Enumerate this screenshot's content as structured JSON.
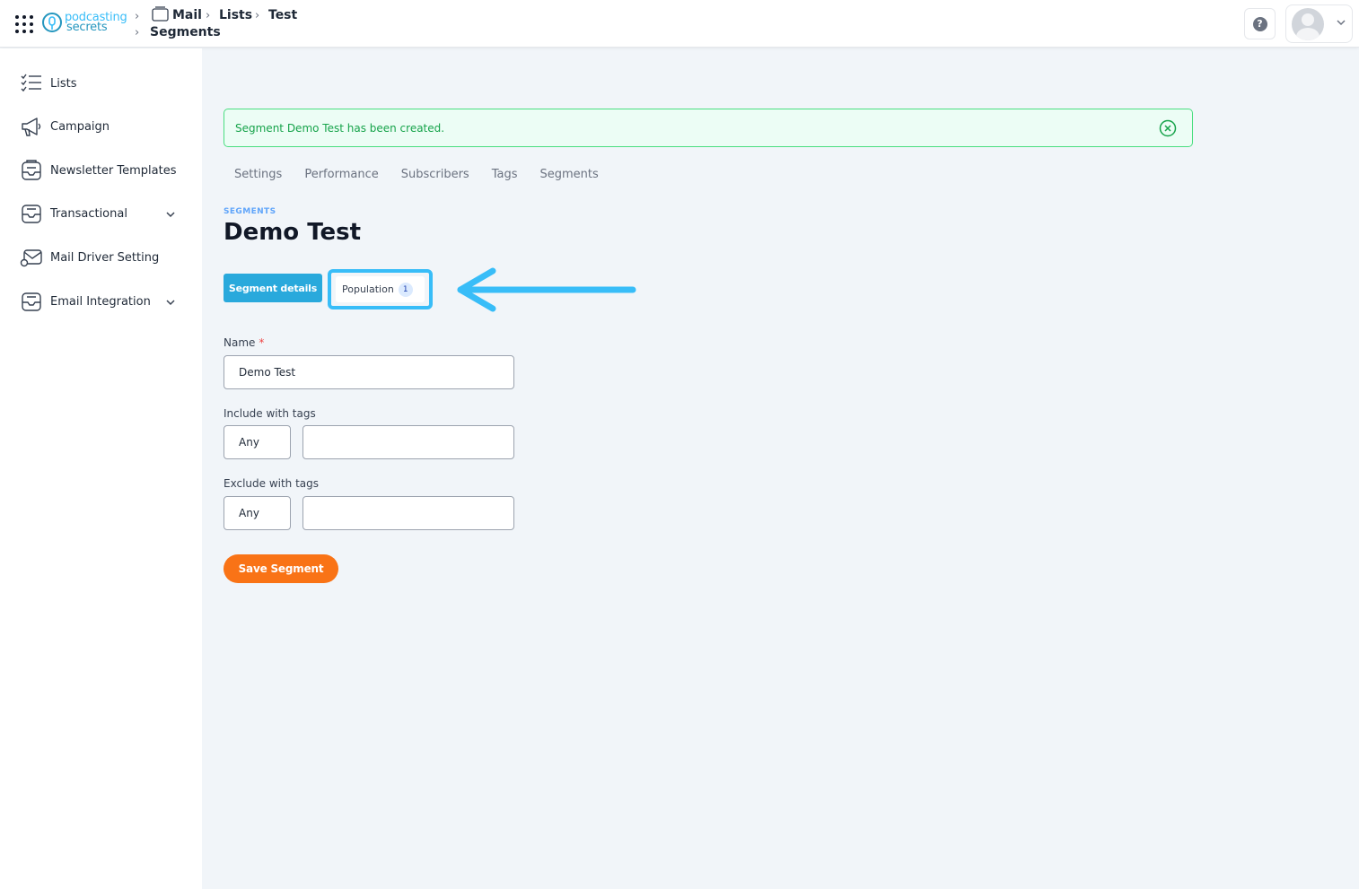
{
  "header": {
    "logo_line1": "podcasting",
    "logo_line2": "secrets",
    "breadcrumb": [
      "Mail",
      "Lists",
      "Test",
      "Segments"
    ],
    "help_icon": "question-circle-icon",
    "avatar_icon": "user-avatar-icon"
  },
  "sidebar": {
    "items": [
      {
        "label": "Lists",
        "icon": "checklist-icon"
      },
      {
        "label": "Campaign",
        "icon": "megaphone-icon"
      },
      {
        "label": "Newsletter Templates",
        "icon": "newsletter-icon"
      },
      {
        "label": "Transactional",
        "icon": "inbox-icon"
      },
      {
        "label": "Mail Driver Setting",
        "icon": "mail-driver-icon"
      },
      {
        "label": "Email Integration",
        "icon": "inbox-icon"
      }
    ]
  },
  "alert": {
    "message": "Segment Demo Test has been created.",
    "color": "#16a34a"
  },
  "tabs": [
    "Settings",
    "Performance",
    "Subscribers",
    "Tags",
    "Segments"
  ],
  "page": {
    "eyebrow": "SEGMENTS",
    "title": "Demo Test"
  },
  "subtabs": {
    "details": "Segment details",
    "population": "Population",
    "population_count": "1"
  },
  "form": {
    "name_label": "Name",
    "required_mark": "*",
    "name_value": "Demo Test",
    "include_label": "Include with tags",
    "include_mode": "Any",
    "include_tags": "",
    "exclude_label": "Exclude with tags",
    "exclude_mode": "Any",
    "exclude_tags": "",
    "save_label": "Save Segment"
  },
  "colors": {
    "primary": "#29a9dc",
    "accent": "#f97316",
    "highlight": "#38bdf8",
    "success": "#16a34a"
  }
}
